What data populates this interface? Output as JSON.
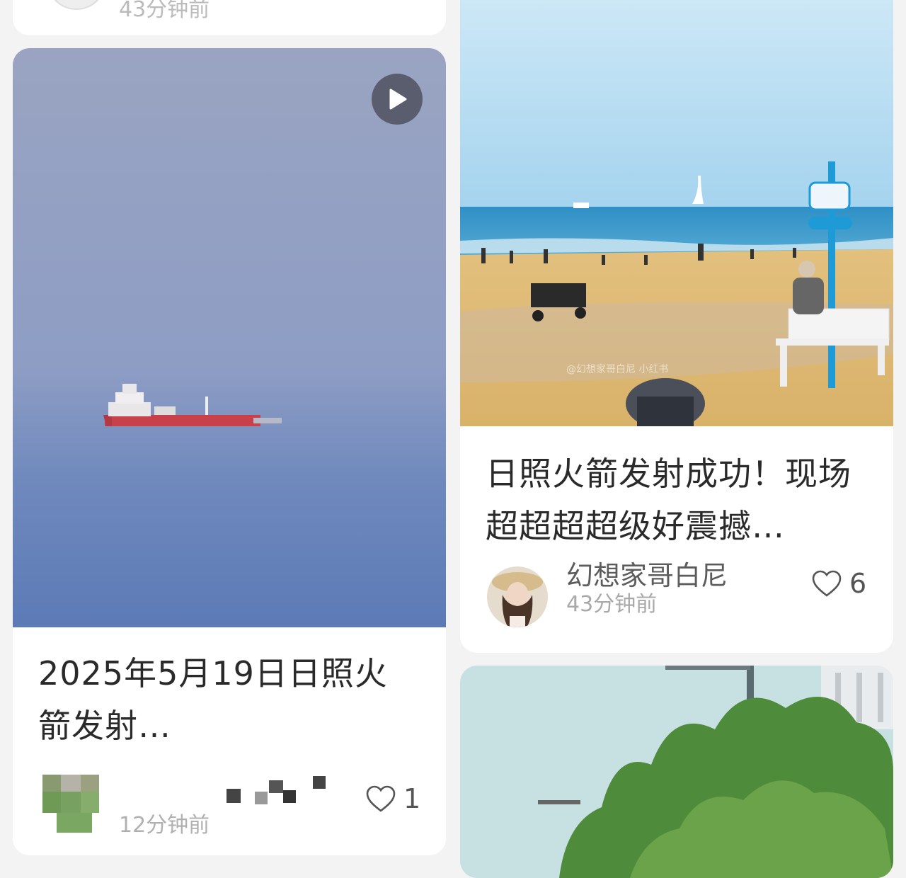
{
  "cards": [
    {
      "id": "top-left-partial",
      "time": "43分钟前"
    },
    {
      "id": "left-video",
      "title": "2025年5月19日日照火箭发射…",
      "likes": "1",
      "time": "12分钟前",
      "media_type": "video",
      "play_icon": "play-icon"
    },
    {
      "id": "right-beach",
      "title": "日照火箭发射成功！现场超超超超级好震撼…",
      "author": "幻想家哥白尼",
      "time": "43分钟前",
      "likes": "6",
      "watermark": "@幻想家哥白尼 小红书"
    },
    {
      "id": "right-trees"
    }
  ],
  "colors": {
    "background": "#f3f3f3",
    "card": "#ffffff",
    "title": "#2a2a2a",
    "muted": "#a9a9a9"
  }
}
